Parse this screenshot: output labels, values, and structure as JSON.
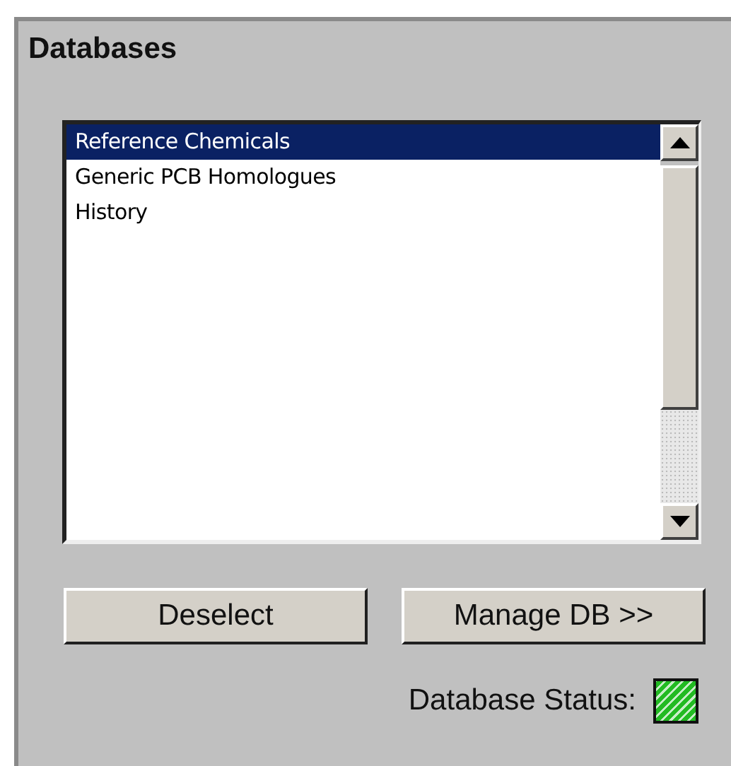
{
  "panel": {
    "title": "Databases"
  },
  "list": {
    "items": [
      {
        "label": "Reference Chemicals",
        "selected": true
      },
      {
        "label": "Generic PCB Homologues",
        "selected": false
      },
      {
        "label": "History",
        "selected": false
      }
    ]
  },
  "buttons": [
    "Deselect",
    "Manage DB >>"
  ],
  "status": {
    "label": "Database Status:",
    "color": "#22bb22"
  }
}
